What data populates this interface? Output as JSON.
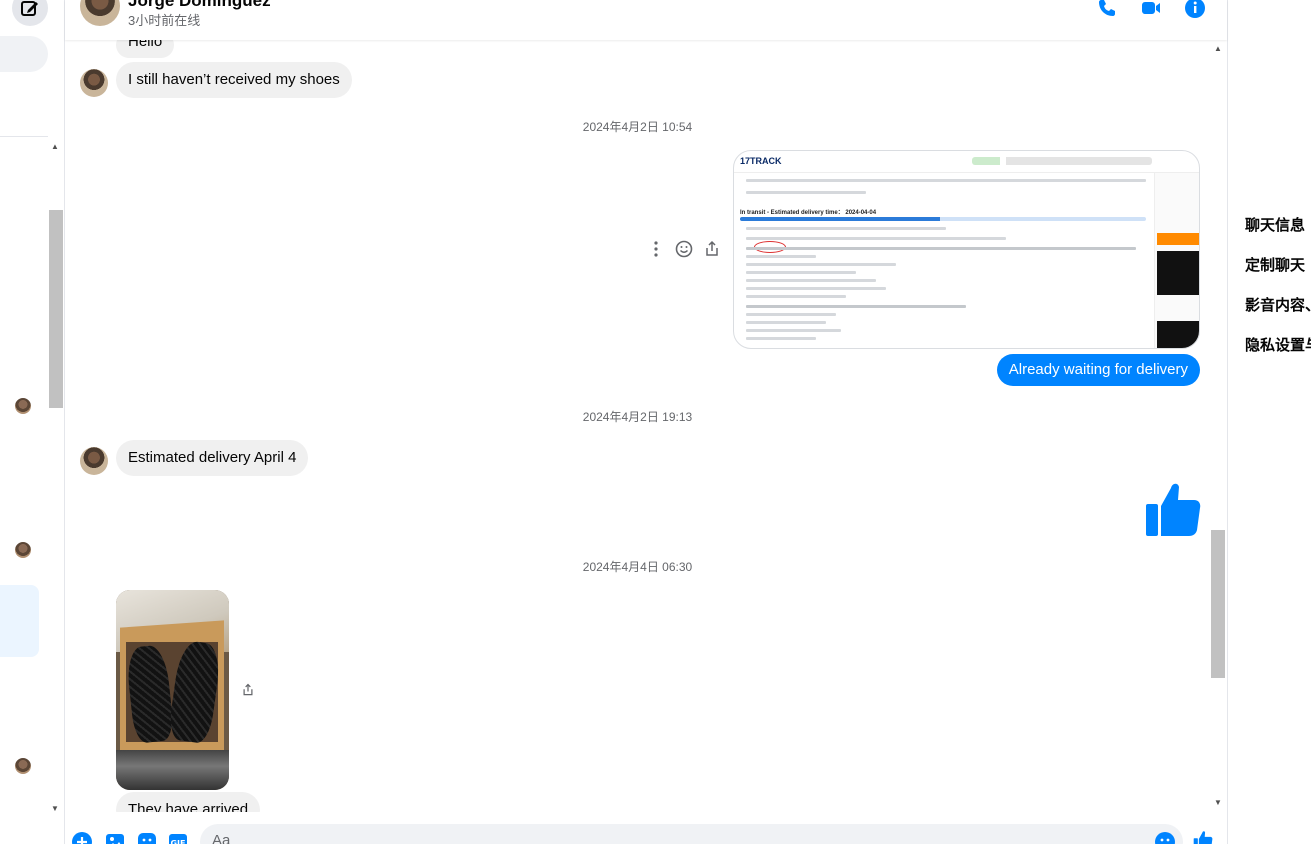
{
  "header": {
    "contact_name": "Jorge Dominguez",
    "contact_status": "3小时前在线"
  },
  "colors": {
    "messenger_blue": "#0084ff",
    "incoming_bubble": "#f0f0f0",
    "timestamp_gray": "#65676b"
  },
  "thread": {
    "messages": [
      {
        "text": "Hello",
        "direction": "incoming"
      },
      {
        "text": "I still haven’t received my shoes",
        "direction": "incoming"
      },
      {
        "timestamp": "2024年4月2日 10:54"
      },
      {
        "text": "Already waiting for delivery",
        "direction": "outgoing"
      },
      {
        "timestamp": "2024年4月2日 19:13"
      },
      {
        "text": "Estimated delivery April 4",
        "direction": "incoming"
      },
      {
        "timestamp": "2024年4月4日 06:30"
      },
      {
        "text": "They have arrived",
        "direction": "incoming"
      }
    ],
    "screenshot": {
      "logo": "17TRACK",
      "status_line": "In transit - Estimated delivery time： 2024-04-04"
    }
  },
  "composer": {
    "placeholder": "Aa"
  },
  "right_panel": {
    "items": [
      "聊天信息",
      "定制聊天",
      "影音内容、",
      "隐私设置与"
    ]
  },
  "icons": {
    "compose": "compose-icon",
    "phone": "phone-icon",
    "video": "video-icon",
    "info": "info-icon",
    "more": "more-options-icon",
    "react": "emoji-reaction-icon",
    "share": "share-icon",
    "like": "thumbs-up-icon",
    "plus": "plus-icon",
    "image": "image-icon",
    "sticker": "sticker-icon",
    "gif": "gif-icon",
    "emoji": "emoji-icon"
  }
}
